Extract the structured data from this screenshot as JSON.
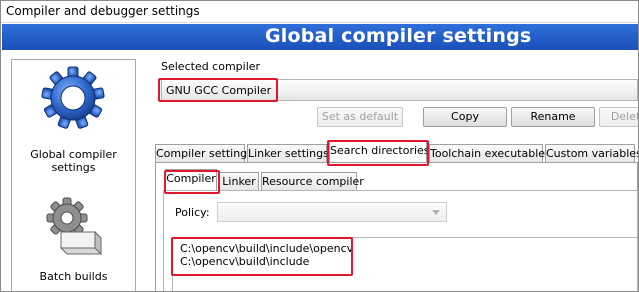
{
  "window": {
    "title": "Compiler and debugger settings"
  },
  "banner": {
    "title": "Global compiler settings"
  },
  "sidebar": {
    "items": [
      {
        "label": "Global compiler settings",
        "icon": "gear-icon",
        "selected": true
      },
      {
        "label": "Batch builds",
        "icon": "batch-builds-icon",
        "selected": false
      }
    ]
  },
  "compiler": {
    "selected_label": "Selected compiler",
    "selected_value": "GNU GCC Compiler"
  },
  "buttons": {
    "set_default": "Set as default",
    "copy": "Copy",
    "rename": "Rename",
    "delete": "Delete"
  },
  "tabs": [
    {
      "label": "Compiler settings",
      "active": false
    },
    {
      "label": "Linker settings",
      "active": false
    },
    {
      "label": "Search directories",
      "active": true
    },
    {
      "label": "Toolchain executables",
      "active": false
    },
    {
      "label": "Custom variables",
      "active": false
    }
  ],
  "subtabs": [
    {
      "label": "Compiler",
      "active": true
    },
    {
      "label": "Linker",
      "active": false
    },
    {
      "label": "Resource compiler",
      "active": false
    }
  ],
  "policy": {
    "label": "Policy:",
    "value": ""
  },
  "directories": [
    "C:\\opencv\\build\\include\\opencv",
    "C:\\opencv\\build\\include"
  ],
  "colors": {
    "banner_top": "#2f6fd9",
    "banner_bottom": "#1a4fb8",
    "highlight": "#e0182e",
    "gear": "#2f66c9"
  }
}
